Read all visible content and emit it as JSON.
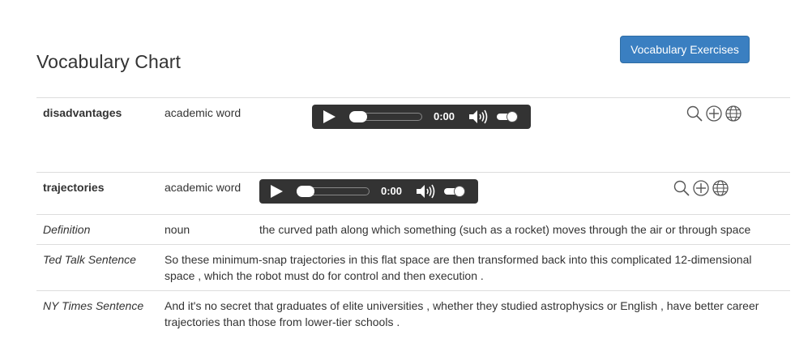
{
  "page": {
    "title": "Vocabulary Chart",
    "exercises_button": "Vocabulary Exercises"
  },
  "words": [
    {
      "word": "disadvantages",
      "category": "academic word",
      "audio_time": "0:00"
    },
    {
      "word": "trajectories",
      "category": "academic word",
      "audio_time": "0:00",
      "details": [
        {
          "label": "Definition",
          "part": "noun",
          "text": "the curved path along which something (such as a rocket) moves through the air or through space"
        },
        {
          "label": "Ted Talk Sentence",
          "line1": "So these minimum-snap trajectories in this flat space are then transformed back into this complicated 12-dimensional",
          "line2": "space , which the robot must do for control and then execution ."
        },
        {
          "label": "NY Times Sentence",
          "line1": "And it's no secret that graduates of elite universities , whether they studied astrophysics or English , have better career",
          "line2": "trajectories than those from lower-tier schools ."
        }
      ]
    }
  ],
  "icons": [
    "search-icon",
    "add-icon",
    "globe-icon"
  ],
  "colors": {
    "button": "#3a7fc1",
    "player": "#333333",
    "divider": "#dddddd"
  }
}
